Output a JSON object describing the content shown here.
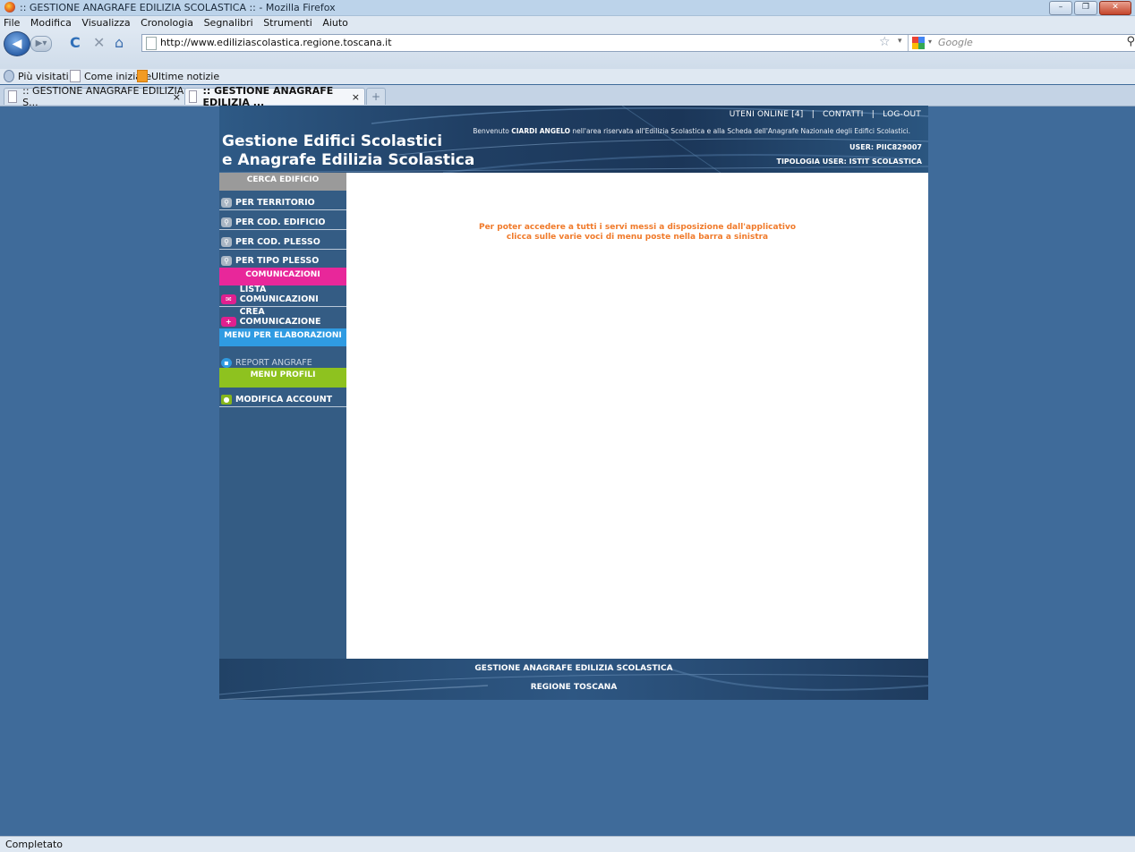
{
  "window": {
    "title": ":: GESTIONE ANAGRAFE EDILIZIA SCOLASTICA :: - Mozilla Firefox",
    "minimize": "–",
    "maximize": "❐",
    "close": "✕"
  },
  "menu": [
    "File",
    "Modifica",
    "Visualizza",
    "Cronologia",
    "Segnalibri",
    "Strumenti",
    "Aiuto"
  ],
  "nav": {
    "url": "http://www.ediliziascolastica.regione.toscana.it",
    "search_placeholder": "Google"
  },
  "bookmarks": [
    "Più visitati",
    "Come iniziare",
    "Ultime notizie"
  ],
  "tabs": [
    {
      "label": ":: GESTIONE ANAGRAFE EDILIZIA S..."
    },
    {
      "label": ":: GESTIONE ANAGRAFE EDILIZIA ..."
    }
  ],
  "header": {
    "brand_line1": "Gestione Edifici Scolastici",
    "brand_line2": "e Anagrafe Edilizia Scolastica",
    "link_online": "UTENI ONLINE [4]",
    "link_contatti": "CONTATTI",
    "link_logout": "LOG-OUT",
    "sep": "|",
    "welcome_prefix": "Benvenuto",
    "welcome_name": "CIARDI ANGELO",
    "welcome_suffix": "nell'area riservata all'Edilizia Scolastica e alla Scheda dell'Anagrafe Nazionale degli Edifici Scolastici.",
    "user": "USER: PIIC829007",
    "tipologia": "TIPOLOGIA USER: ISTIT SCOLASTICA"
  },
  "sidebar": {
    "cerca": {
      "title": "CERCA EDIFICIO",
      "color": "#9a9a9a",
      "items": [
        "PER TERRITORIO",
        "PER COD. EDIFICIO",
        "PER COD. PLESSO",
        "PER TIPO PLESSO"
      ]
    },
    "comunicazioni": {
      "title": "COMUNICAZIONI",
      "color": "#e8279a",
      "items": [
        "LISTA COMUNICAZIONI",
        "CREA COMUNICAZIONE"
      ]
    },
    "elaborazioni": {
      "title": "MENU PER ELABORAZIONI",
      "color": "#2f9be2",
      "items": [
        "REPORT ANGRAFE"
      ]
    },
    "profili": {
      "title": "MENU PROFILI",
      "color": "#8ec21f",
      "items": [
        "MODIFICA ACCOUNT"
      ]
    }
  },
  "content": {
    "line1": "Per poter accedere a tutti i servi messi a disposizione dall'applicativo",
    "line2": "clicca sulle varie voci di menu poste nella barra a sinistra"
  },
  "footer": {
    "line1": "GESTIONE ANAGRAFE EDILIZIA SCOLASTICA",
    "line2": "REGIONE TOSCANA"
  },
  "status": "Completato"
}
